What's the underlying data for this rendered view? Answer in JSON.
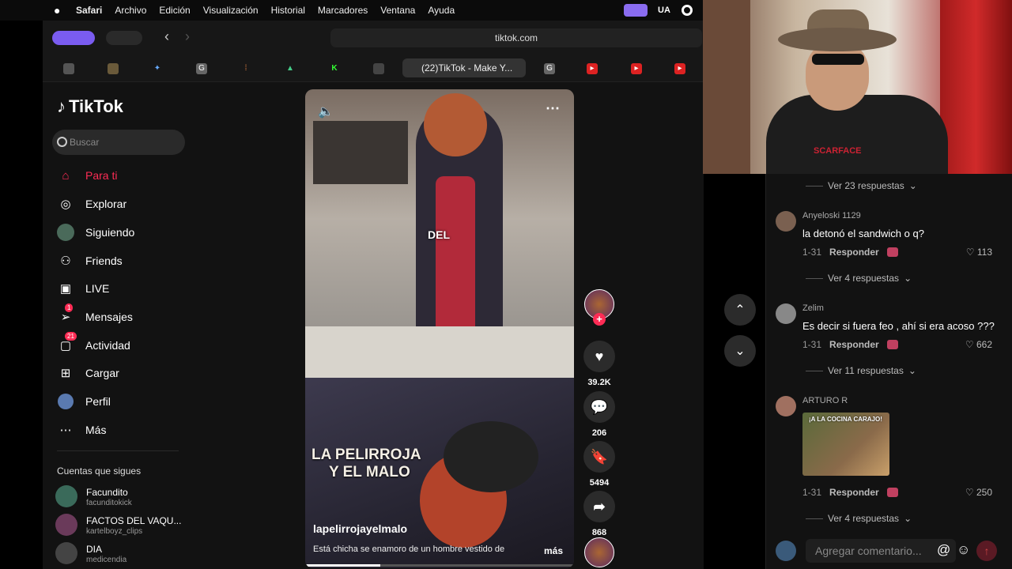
{
  "menubar": {
    "apple": "",
    "items": [
      "Safari",
      "Archivo",
      "Edición",
      "Visualización",
      "Historial",
      "Marcadores",
      "Ventana",
      "Ayuda"
    ],
    "input_source": "UA"
  },
  "browser": {
    "url": "tiktok.com",
    "active_tab": "(22)TikTok - Make Y..."
  },
  "tiktok": {
    "logo": "TikTok",
    "search_placeholder": "Buscar",
    "nav": [
      {
        "label": "Para ti",
        "icon": "home-icon",
        "active": true
      },
      {
        "label": "Explorar",
        "icon": "compass-icon"
      },
      {
        "label": "Siguiendo",
        "icon": "following-icon"
      },
      {
        "label": "Friends",
        "icon": "friends-icon"
      },
      {
        "label": "LIVE",
        "icon": "live-icon"
      },
      {
        "label": "Mensajes",
        "icon": "messages-icon",
        "badge": "1"
      },
      {
        "label": "Actividad",
        "icon": "activity-icon",
        "badge": "21"
      },
      {
        "label": "Cargar",
        "icon": "upload-icon"
      },
      {
        "label": "Perfil",
        "icon": "profile-icon"
      },
      {
        "label": "Más",
        "icon": "more-icon"
      }
    ],
    "following_title": "Cuentas que sigues",
    "following": [
      {
        "name": "Facundito",
        "handle": "facunditokick"
      },
      {
        "name": "FACTOS DEL VAQU...",
        "handle": "kartelboyz_clips"
      },
      {
        "name": "DIA",
        "handle": "medicendia"
      }
    ]
  },
  "video": {
    "overlay_caption": "DEL",
    "title_line1": "LA PELIRROJA",
    "title_line2": "Y EL MALO",
    "author": "lapelirrojayelmalo",
    "description": "Está chicha se enamoro de un hombre vestido de",
    "more": "más",
    "progress": 0.28,
    "likes": "39.2K",
    "comments": "206",
    "saves": "5494",
    "shares": "868"
  },
  "comments": {
    "top_replies": "Ver 23 respuestas",
    "items": [
      {
        "user": "Anyeloski 1129",
        "text": "la detonó el sandwich o q?",
        "date": "1-31",
        "reply": "Responder",
        "likes": "113",
        "replies": "Ver 4 respuestas"
      },
      {
        "user": "Zelim",
        "text": "Es decir si fuera feo , ahí si era acoso ???",
        "date": "1-31",
        "reply": "Responder",
        "likes": "662",
        "replies": "Ver 11 respuestas"
      },
      {
        "user": "ARTURO R",
        "image_caption": "¡A LA COCINA CARAJO!",
        "date": "1-31",
        "reply": "Responder",
        "likes": "250",
        "replies": "Ver 4 respuestas"
      }
    ],
    "add_placeholder": "Agregar comentario..."
  },
  "webcam": {
    "shirt_text": "SCARFACE"
  },
  "colors": {
    "accent": "#fe2c55",
    "page_bg": "#121212",
    "menubar_bg": "#0b0b0b"
  }
}
